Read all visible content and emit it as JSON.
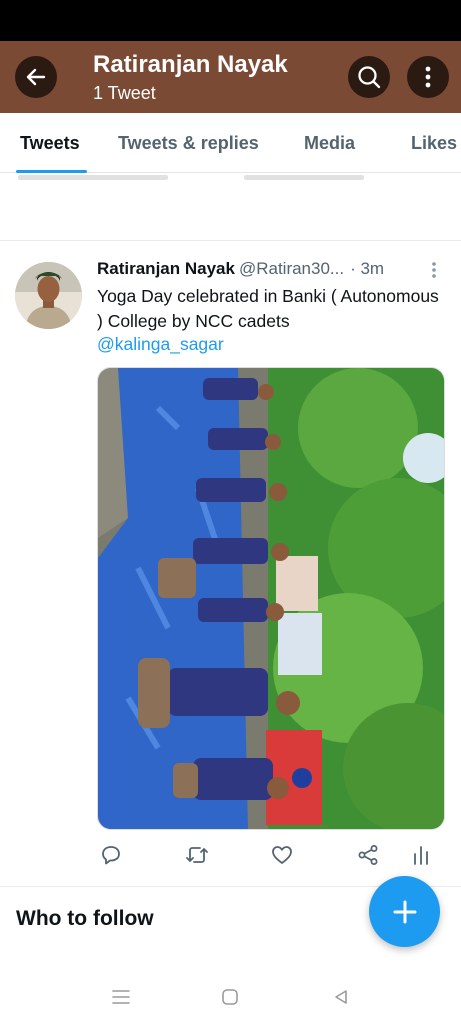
{
  "header": {
    "title": "Ratiranjan Nayak",
    "subtitle": "1 Tweet",
    "back_icon": "arrow-left-icon",
    "search_icon": "search-icon",
    "more_icon": "more-vertical-icon",
    "background_color": "#7a4a35"
  },
  "tabs": [
    {
      "label": "Tweets",
      "active": true
    },
    {
      "label": "Tweets & replies",
      "active": false
    },
    {
      "label": "Media",
      "active": false
    },
    {
      "label": "Likes",
      "active": false
    }
  ],
  "accent_color": "#1d9bf0",
  "tweet": {
    "author_name": "Ratiranjan Nayak",
    "author_handle": "@Ratiran30...",
    "time": "· 3m",
    "text": "Yoga Day celebrated in Banki ( Autonomous ) College by NCC cadets",
    "mention": "@kalinga_sagar",
    "actions": [
      "reply-icon",
      "retweet-icon",
      "like-icon",
      "share-icon",
      "analytics-icon"
    ]
  },
  "who_to_follow": {
    "title": "Who to follow"
  },
  "fab": {
    "icon": "plus-icon"
  },
  "system_nav": [
    "recent-apps-icon",
    "home-icon",
    "back-icon"
  ]
}
